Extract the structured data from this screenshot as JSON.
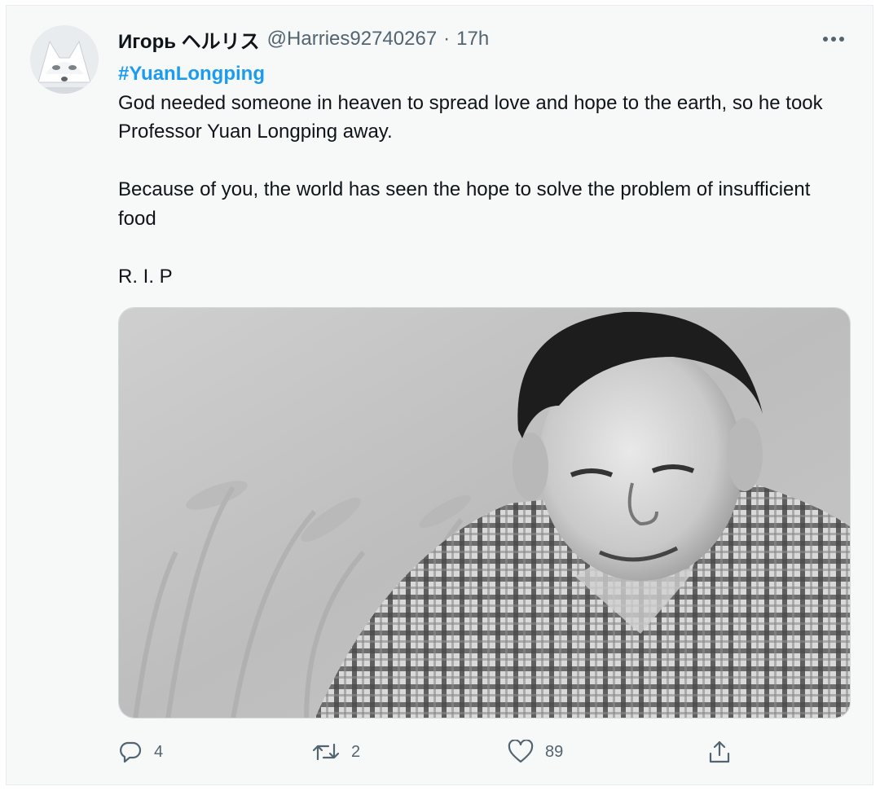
{
  "author": {
    "display_name": "Игорь ヘルリス",
    "handle": "@Harries92740267",
    "separator": "·",
    "time": "17h",
    "avatar_icon": "white-fox-avatar"
  },
  "menu_icon": "more-horizontal-icon",
  "tweet": {
    "hashtag": "#YuanLongping",
    "paragraph_1": "God needed someone in heaven to spread love and hope to the earth, so he took Professor Yuan Longping away.",
    "paragraph_2": "Because of you, the world has seen the hope to solve the problem of insufficient food",
    "paragraph_3": "R. I. P"
  },
  "media": {
    "type": "photo",
    "style": "black-and-white"
  },
  "actions": {
    "reply_icon": "reply-bubble-icon",
    "reply_count": "4",
    "retweet_icon": "retweet-icon",
    "retweet_count": "2",
    "like_icon": "heart-icon",
    "like_count": "89",
    "share_icon": "share-icon"
  },
  "colors": {
    "hashtag": "#1d9bf0",
    "secondary_text": "#536471",
    "card_background": "#f7f9f9"
  }
}
